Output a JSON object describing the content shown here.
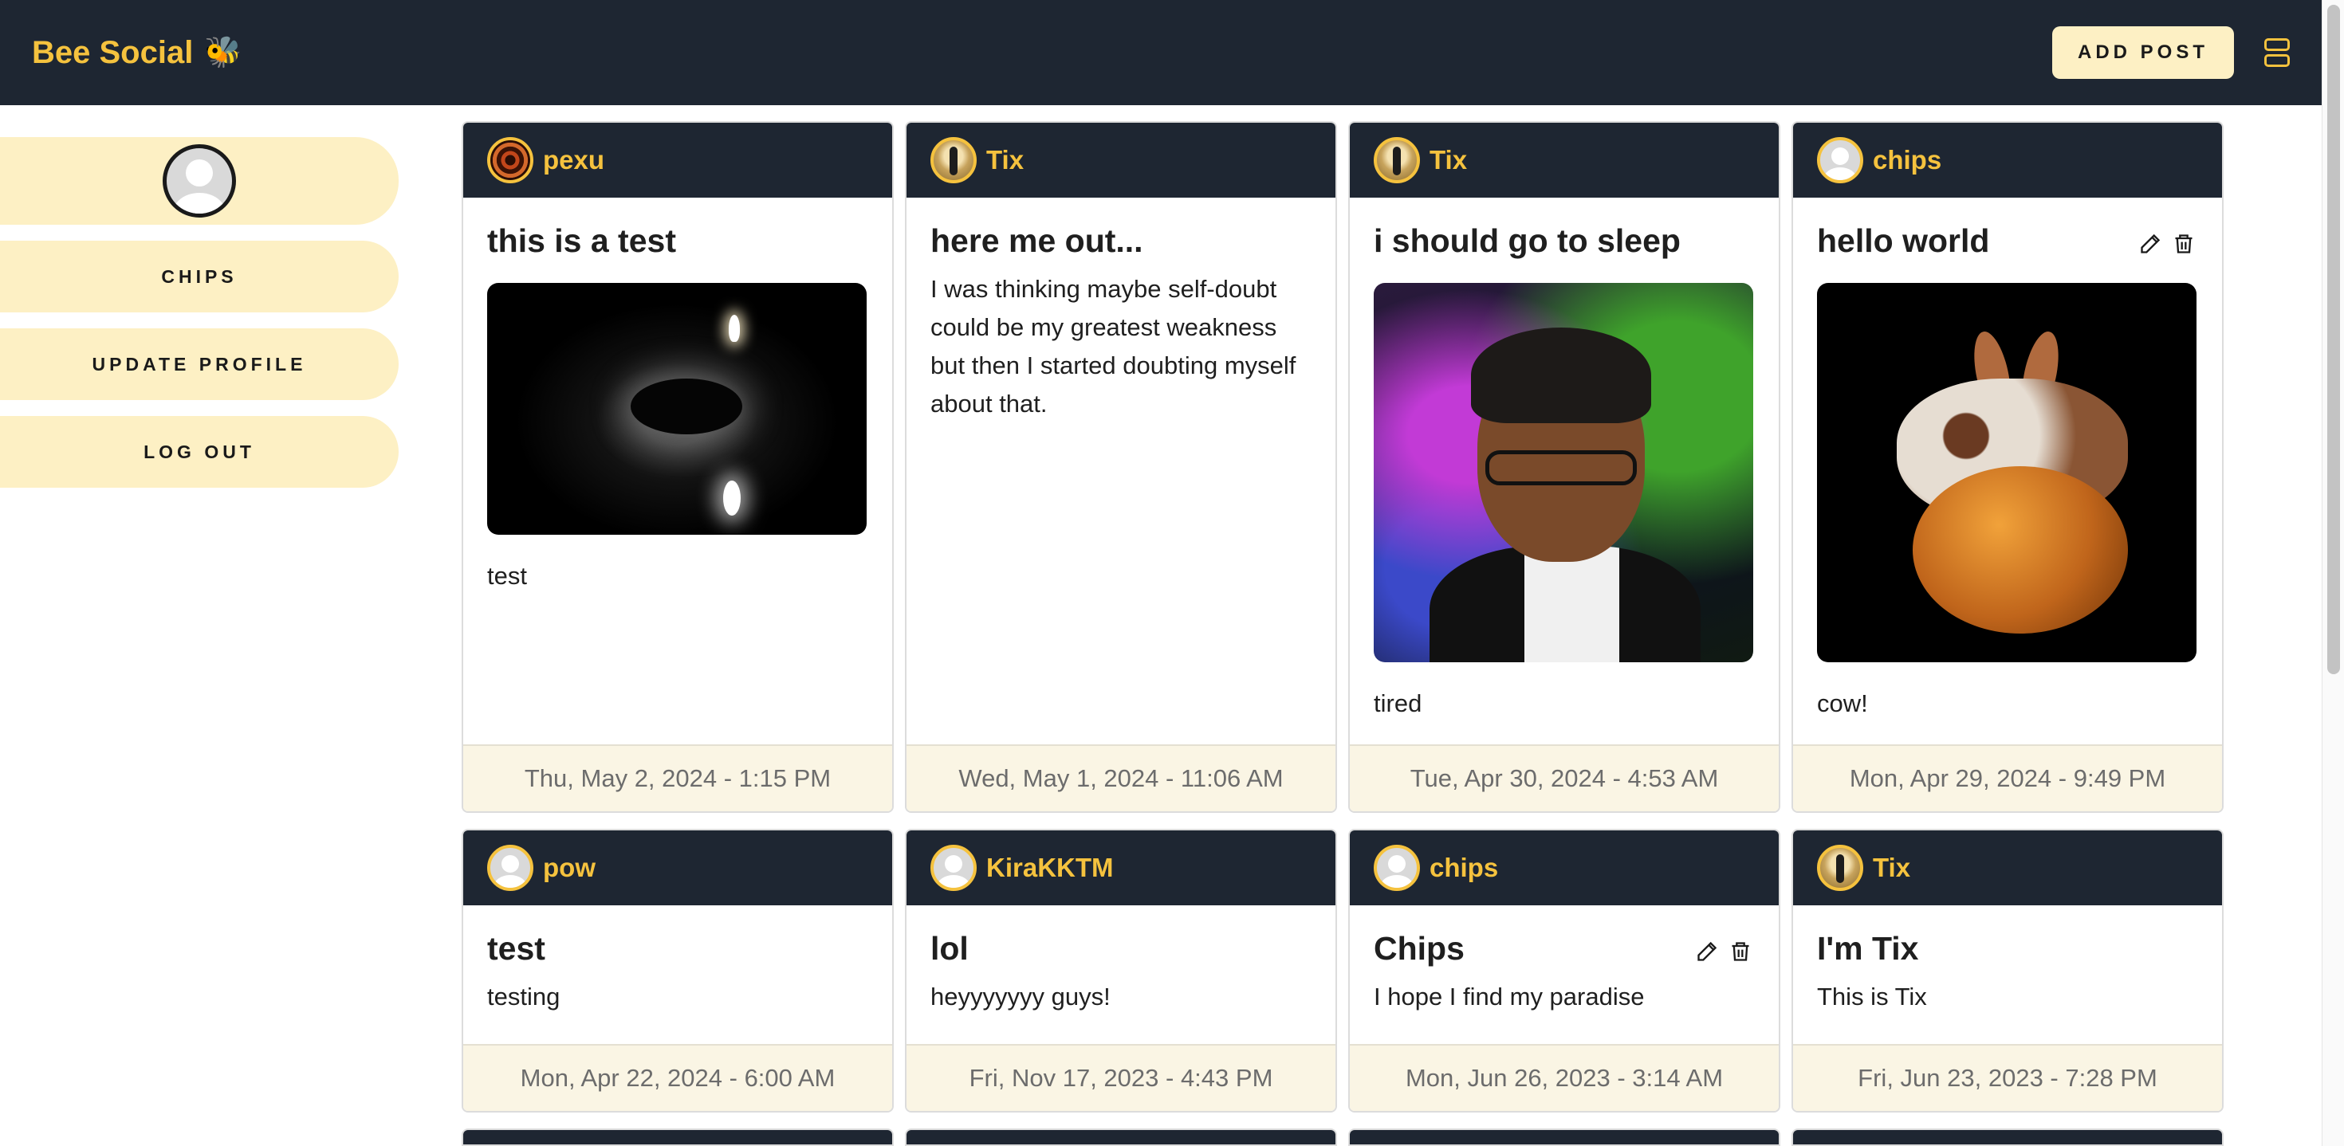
{
  "app": {
    "brand": "Bee Social",
    "brand_emoji": "🐝"
  },
  "header": {
    "add_post_label": "ADD POST"
  },
  "sidebar": {
    "username_button": "CHIPS",
    "update_profile": "UPDATE PROFILE",
    "log_out": "LOG OUT"
  },
  "posts": [
    {
      "username": "pexu",
      "title": "this is a test",
      "text": "test",
      "date": "Thu, May 2, 2024 - 1:15 PM",
      "avatar": "spiral-avatar",
      "image": "candle-image"
    },
    {
      "username": "Tix",
      "title": "here me out...",
      "text": "I was thinking maybe self-doubt could be my greatest weakness but then I started doubting myself about that.",
      "date": "Wed, May 1, 2024 - 11:06 AM",
      "avatar": "figure-avatar"
    },
    {
      "username": "Tix",
      "title": "i should go to sleep",
      "text": "tired",
      "date": "Tue, Apr 30, 2024 - 4:53 AM",
      "avatar": "figure-avatar",
      "image": "memoji-image"
    },
    {
      "username": "chips",
      "title": "hello world",
      "text": "cow!",
      "date": "Mon, Apr 29, 2024 - 9:49 PM",
      "avatar": "default-avatar",
      "image": "cow-image",
      "editable": true
    },
    {
      "username": "pow",
      "title": "test",
      "text": "testing",
      "date": "Mon, Apr 22, 2024 - 6:00 AM",
      "avatar": "default-avatar"
    },
    {
      "username": "KiraKKTM",
      "title": "lol",
      "text": "heyyyyyyy guys!",
      "date": "Fri, Nov 17, 2023 - 4:43 PM",
      "avatar": "default-avatar"
    },
    {
      "username": "chips",
      "title": "Chips",
      "text": "I hope I find my paradise",
      "date": "Mon, Jun 26, 2023 - 3:14 AM",
      "avatar": "default-avatar",
      "editable": true
    },
    {
      "username": "Tix",
      "title": "I'm Tix",
      "text": "This is Tix",
      "date": "Fri, Jun 23, 2023 - 7:28 PM",
      "avatar": "figure-avatar"
    }
  ],
  "colors": {
    "navbar": "#1e2632",
    "accent": "#f5c23e",
    "pill": "#fdf0c4",
    "footer": "#faf5e4"
  }
}
